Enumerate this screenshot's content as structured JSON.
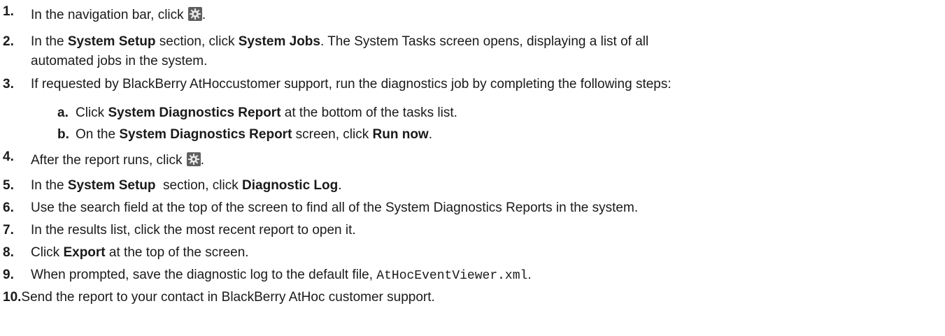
{
  "steps": [
    {
      "num": "1.",
      "pre": "In the navigation bar, click ",
      "icon": "gear-icon",
      "post": "."
    },
    {
      "num": "2.",
      "pre": "In the ",
      "b1": "System Setup",
      "mid": " section, click ",
      "b2": "System Jobs",
      "post": ". The System Tasks screen opens, displaying a list of all",
      "line2": "automated jobs in the system."
    },
    {
      "num": "3.",
      "text": "If requested by BlackBerry AtHoccustomer support, run the diagnostics job by completing the following steps:"
    },
    {
      "num": "4.",
      "pre": "After the report runs, click ",
      "icon": "gear-icon",
      "post": "."
    },
    {
      "num": "5.",
      "pre": "In the ",
      "b1": "System Setup",
      "mid": "  section, click ",
      "b2": "Diagnostic Log",
      "post": "."
    },
    {
      "num": "6.",
      "text": "Use the search field at the top of the screen to find all of the System Diagnostics Reports in the system."
    },
    {
      "num": "7.",
      "text": "In the results list, click the most recent report to open it."
    },
    {
      "num": "8.",
      "pre": "Click ",
      "b1": "Export",
      "post": " at the top of the screen."
    },
    {
      "num": "9.",
      "pre": "When prompted, save the diagnostic log to the default file, ",
      "code": "AtHocEventViewer.xml",
      "post": "."
    },
    {
      "num": "10.",
      "text": "Send the report to your contact in BlackBerry AtHoc customer support."
    }
  ],
  "substeps": [
    {
      "num": "a.",
      "pre": "Click ",
      "b1": "System Diagnostics Report",
      "post": " at the bottom of the tasks list."
    },
    {
      "num": "b.",
      "pre": "On the ",
      "b1": "System Diagnostics Report",
      "mid": " screen, click ",
      "b2": "Run now",
      "post": "."
    }
  ]
}
